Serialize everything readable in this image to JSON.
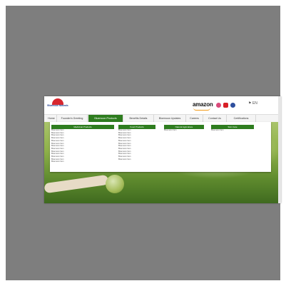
{
  "header": {
    "logo_text": "Bluemoon\nNaturals",
    "amazon_label": "amazon",
    "lang_label": "EN"
  },
  "nav": {
    "items": [
      {
        "label": "Home"
      },
      {
        "label": "Founder's Greeting"
      },
      {
        "label": "Bluemoon Products"
      },
      {
        "label": "Benefits Details"
      },
      {
        "label": "Bluemoon Updates"
      },
      {
        "label": "Careers"
      },
      {
        "label": "Contact Us"
      },
      {
        "label": "Certifications"
      }
    ]
  },
  "dropdown": {
    "columns": [
      {
        "title": "Medicinal Products",
        "items": [
          "Bluemoon Item",
          "Bluemoon Item",
          "Bluemoon Item",
          "Bluemoon Item",
          "Bluemoon Item",
          "Bluemoon Item",
          "Bluemoon Item",
          "Bluemoon Item",
          "Bluemoon Item",
          "Bluemoon Item",
          "Bluemoon Item",
          "Bluemoon Item",
          "Bluemoon Item"
        ]
      },
      {
        "title": "Food Products",
        "items": [
          "Bluemoon Item",
          "Bluemoon Item",
          "Bluemoon Item",
          "Bluemoon Item",
          "Bluemoon Item",
          "Bluemoon Item",
          "Bluemoon Item",
          "Bluemoon Item",
          "Bluemoon Item",
          "Bluemoon Item",
          "Bluemoon Item",
          "Bluemoon Item"
        ]
      },
      {
        "title": "Natural Agriculture",
        "items": [
          "Bluemoon Item"
        ]
      },
      {
        "title": "Skin Care",
        "items": [
          "Bluemoon Item"
        ]
      }
    ]
  },
  "colors": {
    "accent_green": "#2e7d1f",
    "brand_red": "#d7262e",
    "brand_blue": "#1e3c8c",
    "frame_gray": "#7e7e7e"
  },
  "icons": [
    "instagram-icon",
    "youtube-icon",
    "facebook-icon",
    "flag-icon"
  ]
}
